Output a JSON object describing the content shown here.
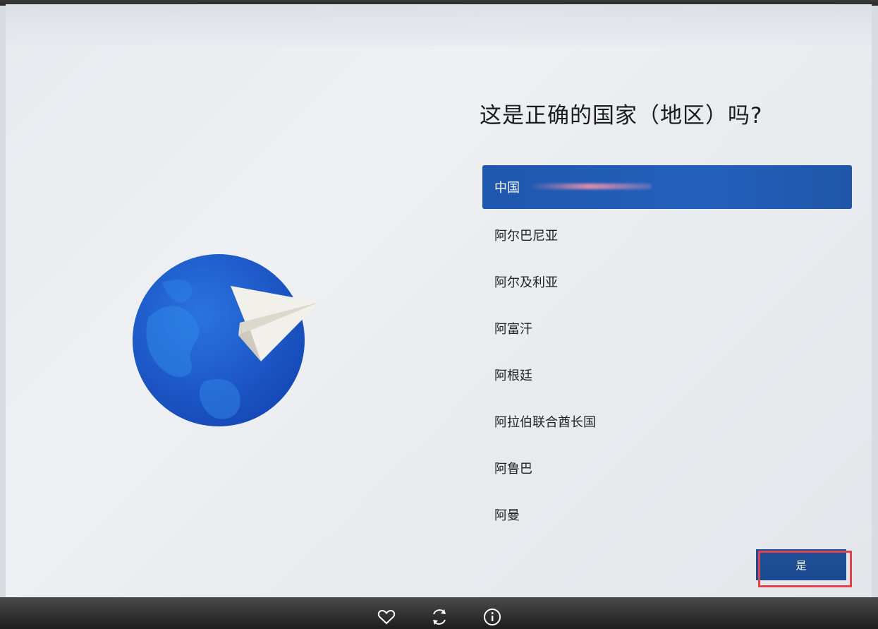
{
  "setup": {
    "question": "这是正确的国家（地区）吗?",
    "countries": [
      {
        "label": "中国",
        "selected": true
      },
      {
        "label": "阿尔巴尼亚",
        "selected": false
      },
      {
        "label": "阿尔及利亚",
        "selected": false
      },
      {
        "label": "阿富汗",
        "selected": false
      },
      {
        "label": "阿根廷",
        "selected": false
      },
      {
        "label": "阿拉伯联合酋长国",
        "selected": false
      },
      {
        "label": "阿鲁巴",
        "selected": false
      },
      {
        "label": "阿曼",
        "selected": false
      }
    ],
    "yes_label": "是"
  },
  "viewer_toolbar": {
    "icons": [
      "heart-icon",
      "rotate-icon",
      "info-icon"
    ]
  },
  "colors": {
    "accent": "#2360bd",
    "button": "#1b4a8f",
    "highlight": "#e0414b"
  }
}
